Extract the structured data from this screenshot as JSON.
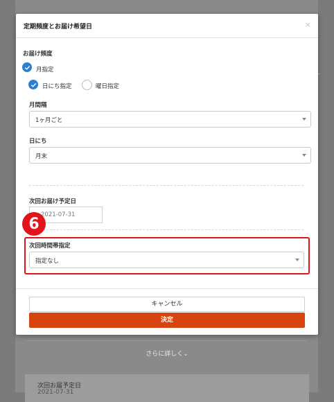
{
  "modal": {
    "title": "定期頻度とお届け希望日",
    "close_glyph": "×"
  },
  "frequency": {
    "section_label": "お届け頻度",
    "monthly_label": "月指定",
    "day_option_label": "日にち指定",
    "weekday_option_label": "曜日指定"
  },
  "interval": {
    "label": "月間隔",
    "value": "1ヶ月ごと"
  },
  "day": {
    "label": "日にち",
    "value": "月末"
  },
  "next_delivery": {
    "label": "次回お届け予定日",
    "value": "2021-07-31"
  },
  "time_slot": {
    "label": "次回時間帯指定",
    "value": "指定なし"
  },
  "annotation": {
    "step_number": "6",
    "highlight_color": "#e0141a"
  },
  "buttons": {
    "cancel": "キャンセル",
    "confirm": "決定",
    "confirm_color": "#d84410"
  },
  "background": {
    "more_link": "さらに詳しく⌄",
    "card_title": "次回お届予定日",
    "card_value": "2021-07-31"
  },
  "icons": [
    "check-icon",
    "close-icon",
    "chevron-down-icon"
  ]
}
